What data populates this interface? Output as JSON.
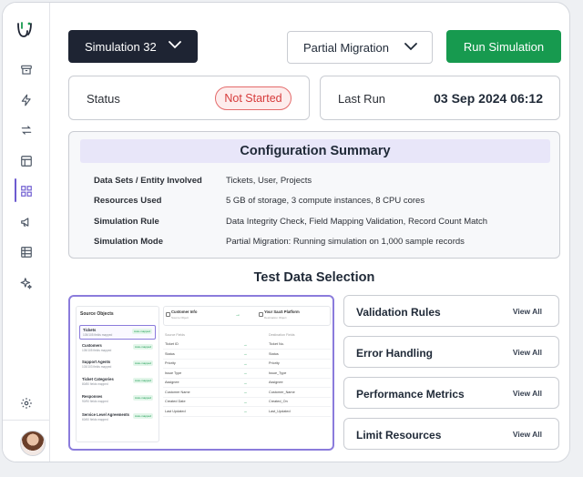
{
  "header": {
    "simulation_select": "Simulation 32",
    "mode_select": "Partial Migration",
    "run_button": "Run Simulation"
  },
  "status": {
    "label": "Status",
    "value": "Not Started",
    "last_run_label": "Last Run",
    "last_run_value": "03 Sep 2024 06:12"
  },
  "config": {
    "title": "Configuration Summary",
    "rows": [
      {
        "key": "Data Sets / Entity Involved",
        "value": "Tickets, User, Projects"
      },
      {
        "key": "Resources Used",
        "value": "5 GB of storage, 3 compute instances, 8 CPU cores"
      },
      {
        "key": "Simulation Rule",
        "value": "Data Integrity Check, Field Mapping Validation, Record Count Match"
      },
      {
        "key": "Simulation Mode",
        "value": "Partial Migration: Running simulation on 1,000 sample records"
      }
    ]
  },
  "test_data": {
    "title": "Test Data Selection",
    "preview": {
      "source_title": "Source Objects",
      "objects": [
        {
          "name": "Tickets",
          "sub": "105/105 fields mapped",
          "badge": "Auto-mapped"
        },
        {
          "name": "Customers",
          "sub": "105/105 fields mapped",
          "badge": "Auto-mapped"
        },
        {
          "name": "Support Agents",
          "sub": "103/103 fields mapped",
          "badge": "Auto-mapped"
        },
        {
          "name": "Ticket Categories",
          "sub": "80/80 fields mapped",
          "badge": "Auto-mapped"
        },
        {
          "name": "Responses",
          "sub": "90/90 fields mapped",
          "badge": "Auto-mapped"
        },
        {
          "name": "Service Level Agreements",
          "sub": "60/60 fields mapped",
          "badge": "Auto-mapped"
        }
      ],
      "source_entity": "Customer Info",
      "source_entity_sub": "Source Object",
      "dest_entity": "Your SaaS Platform",
      "dest_entity_sub": "Destination Object",
      "source_fields_header": "Source Fields",
      "dest_fields_header": "Destination Fields",
      "source_fields": [
        "Ticket ID",
        "Status",
        "Priority",
        "Issue Type",
        "Assignee",
        "Customer Name",
        "Created Date",
        "Last Updated"
      ],
      "dest_fields": [
        "Ticket No.",
        "Status",
        "Priority",
        "Issue_Type",
        "Assignee",
        "Customer_Name",
        "Created_On",
        "Last_Updated"
      ],
      "arrow": "→"
    },
    "tiles": [
      {
        "title": "Validation Rules",
        "action": "View All"
      },
      {
        "title": "Error Handling",
        "action": "View All"
      },
      {
        "title": "Performance Metrics",
        "action": "View All"
      },
      {
        "title": "Limit Resources",
        "action": "View All"
      }
    ]
  },
  "colors": {
    "run_button": "#179a4f",
    "status_not_started": "#d63b3b",
    "accent": "#6d5bd0",
    "dark_select": "#1e2433"
  },
  "icons": {
    "sidebar": [
      "logo-icon",
      "archive-icon",
      "lightning-icon",
      "transfer-icon",
      "layout-icon",
      "grid-icon",
      "megaphone-icon",
      "table-icon",
      "sparkle-icon",
      "gear-icon"
    ]
  }
}
